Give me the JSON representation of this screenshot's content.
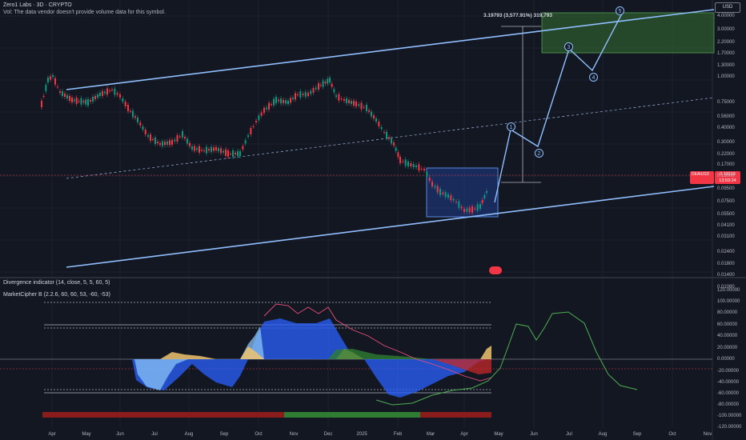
{
  "header": {
    "symbol_line": "Zero1 Labs · 3D · CRYPTO",
    "volume_note": "Vol: The data vendor doesn't provide volume data for this symbol."
  },
  "currency_button": "USD",
  "price_axis": [
    "4.00000",
    "3.00000",
    "2.20000",
    "1.70000",
    "1.30000",
    "1.00000",
    "0.75000",
    "0.56000",
    "0.40000",
    "0.30000",
    "0.22000",
    "0.17000",
    "0.13000",
    "0.09500",
    "0.07500",
    "0.05500",
    "0.04100",
    "0.03100",
    "0.02400",
    "0.01800",
    "0.01400",
    "0.01080"
  ],
  "current_price": {
    "symbol": "DEAIUSD",
    "value": "0.10119",
    "countdown": "13:59:24"
  },
  "measure_label": "3.19793 (3,577.91%) 319,793",
  "wave_labels": [
    "1",
    "2",
    "3",
    "4",
    "5"
  ],
  "indicators": {
    "divergence": "Divergence indicator (14, close, 5, 5, 60, 5)",
    "marketcipher": "MarketCipher B (2.2.6, 60, 60, 53, -60, -53)"
  },
  "osc_axis": [
    "120.00000",
    "100.00000",
    "80.00000",
    "60.00000",
    "40.00000",
    "20.00000",
    "0.00000",
    "-20.00000",
    "-40.00000",
    "-60.00000",
    "-80.00000",
    "-100.00000",
    "-120.00000"
  ],
  "time_axis": [
    "Apr",
    "May",
    "Jun",
    "Jul",
    "Aug",
    "Sep",
    "Oct",
    "Nov",
    "Dec",
    "2025",
    "Feb",
    "Mar",
    "Apr",
    "May",
    "Jun",
    "Jul",
    "Aug",
    "Sep",
    "Oct",
    "Nov"
  ],
  "colors": {
    "bg": "#131722",
    "up": "#089981",
    "down": "#f23645",
    "channel": "#90bfff",
    "target_box": "#2e5a2e",
    "wave": "#1f5fc4"
  }
}
